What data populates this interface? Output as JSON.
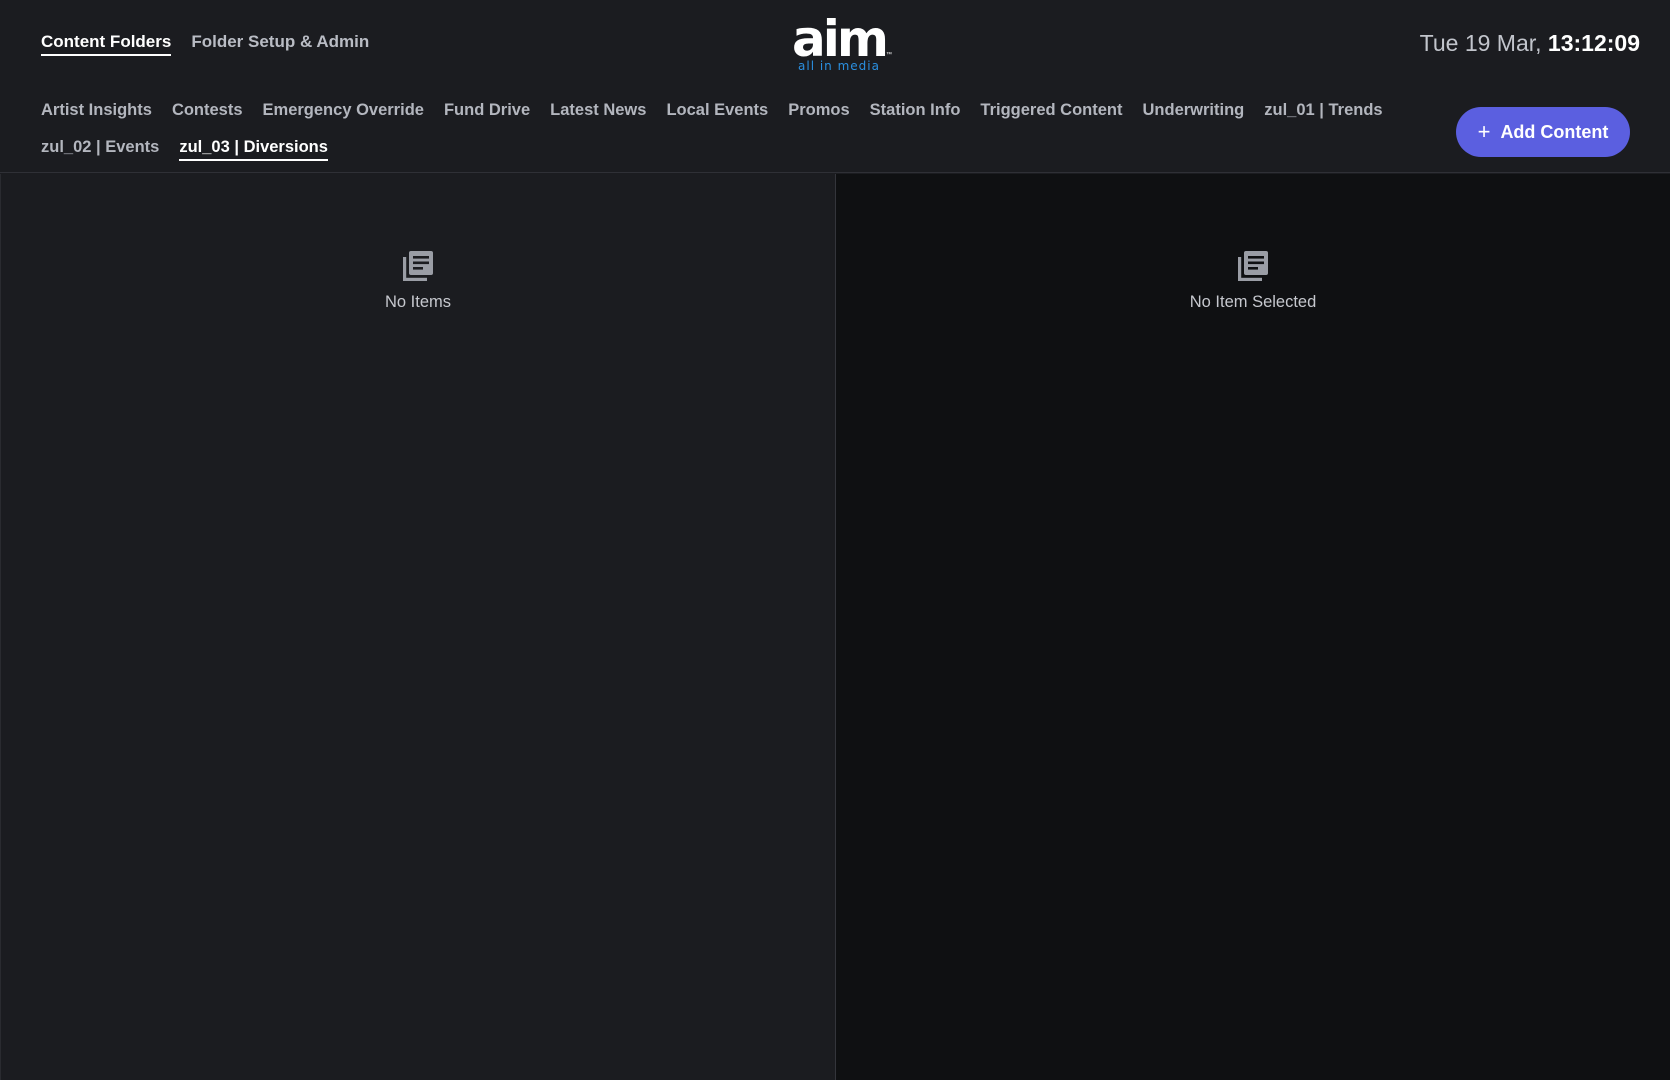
{
  "header": {
    "main_tabs": [
      {
        "label": "Content Folders",
        "active": true
      },
      {
        "label": "Folder Setup & Admin",
        "active": false
      }
    ],
    "logo": {
      "word": "aim",
      "tagline": "all in media",
      "trademark": "™"
    },
    "clock": {
      "date": "Tue 19 Mar,",
      "time": "13:12:09"
    }
  },
  "folders": {
    "tabs": [
      {
        "label": "Artist Insights",
        "active": false
      },
      {
        "label": "Contests",
        "active": false
      },
      {
        "label": "Emergency Override",
        "active": false
      },
      {
        "label": "Fund Drive",
        "active": false
      },
      {
        "label": "Latest News",
        "active": false
      },
      {
        "label": "Local Events",
        "active": false
      },
      {
        "label": "Promos",
        "active": false
      },
      {
        "label": "Station Info",
        "active": false
      },
      {
        "label": "Triggered Content",
        "active": false
      },
      {
        "label": "Underwriting",
        "active": false
      },
      {
        "label": "zul_01 | Trends",
        "active": false
      },
      {
        "label": "zul_02 | Events",
        "active": false
      },
      {
        "label": "zul_03 | Diversions",
        "active": true
      }
    ],
    "add_button": {
      "label": "Add Content",
      "icon": "plus-icon"
    }
  },
  "list_pane": {
    "empty_text": "No Items",
    "icon": "news-icon"
  },
  "detail_pane": {
    "empty_text": "No Item Selected",
    "icon": "news-icon"
  },
  "colors": {
    "accent": "#5b5fe0",
    "background": "#1b1c20",
    "detail_background": "#0f1012",
    "logo_tagline": "#2a8fe0"
  }
}
